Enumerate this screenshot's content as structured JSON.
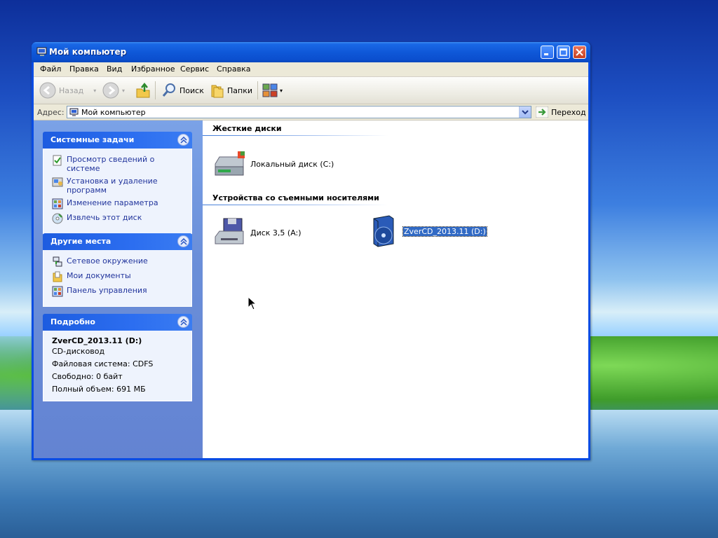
{
  "window": {
    "title": "Мой компьютер"
  },
  "menu": [
    "Файл",
    "Правка",
    "Вид",
    "Избранное",
    "Сервис",
    "Справка"
  ],
  "toolbar": {
    "back": "Назад",
    "search": "Поиск",
    "folders": "Папки"
  },
  "address": {
    "label": "Адрес:",
    "value": "Мой компьютер",
    "go": "Переход"
  },
  "system_tasks": {
    "title": "Системные задачи",
    "items": [
      "Просмотр сведений о системе",
      "Установка и удаление программ",
      "Изменение параметра",
      "Извлечь этот диск"
    ]
  },
  "other_places": {
    "title": "Другие места",
    "items": [
      "Сетевое окружение",
      "Мои документы",
      "Панель управления"
    ]
  },
  "details": {
    "title": "Подробно",
    "name": "ZverCD_2013.11 (D:)",
    "type": "CD-дисковод",
    "fs": "Файловая система: CDFS",
    "free": "Свободно: 0 байт",
    "total": "Полный объем: 691 МБ"
  },
  "groups": {
    "hard": {
      "title": "Жесткие диски",
      "items": [
        "Локальный диск (C:)"
      ]
    },
    "removable": {
      "title": "Устройства со съемными носителями",
      "items": [
        "Диск 3,5 (A:)",
        "ZverCD_2013.11 (D:)"
      ]
    }
  }
}
